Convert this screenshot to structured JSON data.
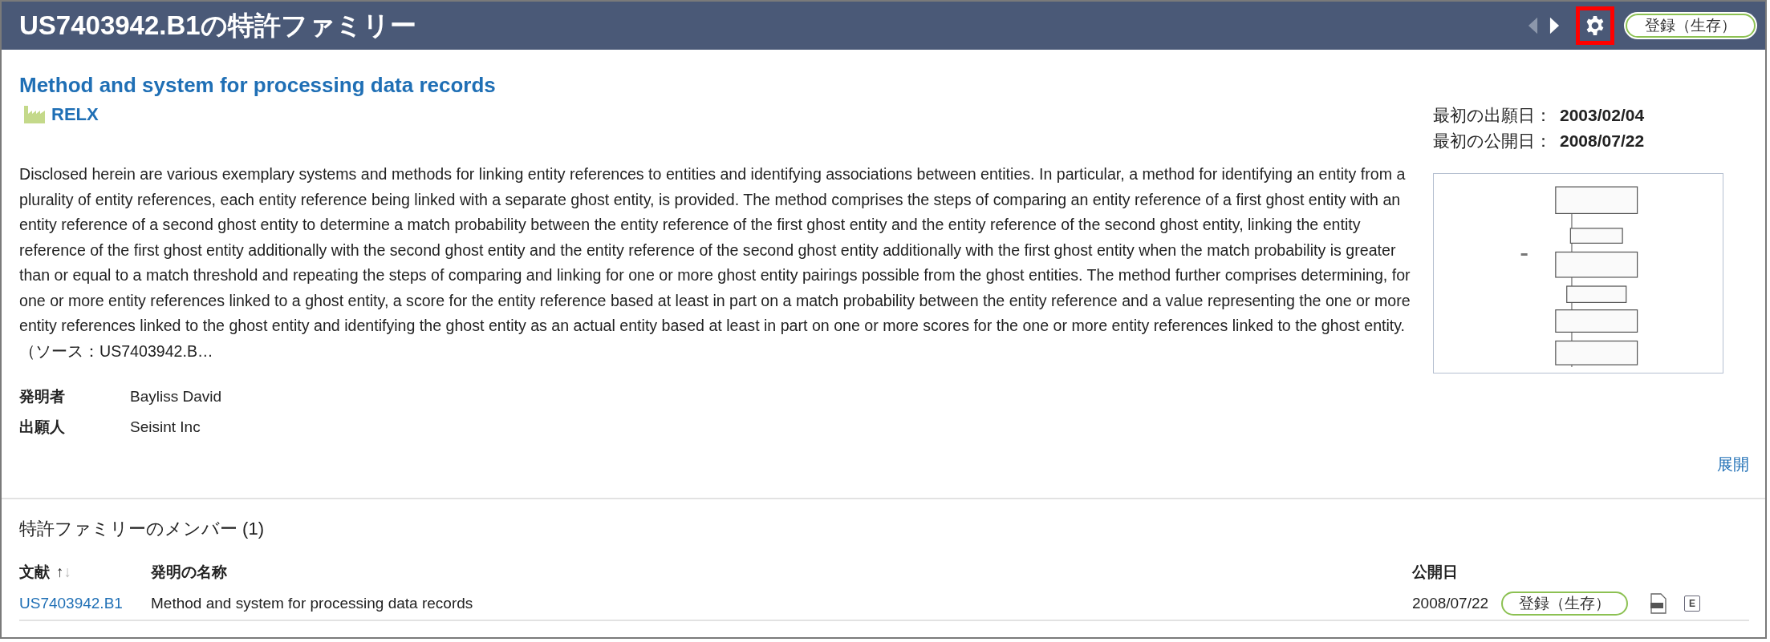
{
  "header": {
    "title": "US7403942.B1の特許ファミリー",
    "prev_enabled": false,
    "next_enabled": true,
    "settings_highlighted": true,
    "status_badge": "登録（生存）"
  },
  "patent": {
    "title": "Method and system for processing data records",
    "assignee": "RELX",
    "dates": [
      {
        "label": "最初の出願日：",
        "value": "2003/02/04"
      },
      {
        "label": "最初の公開日：",
        "value": "2008/07/22"
      }
    ],
    "abstract": "Disclosed herein are various exemplary systems and methods for linking entity references to entities and identifying associations between entities. In particular, a method for identifying an entity from a plurality of entity references, each entity reference being linked with a separate ghost entity, is provided. The method comprises the steps of comparing an entity reference of a first ghost entity with an entity reference of a second ghost entity to determine a match probability between the entity reference of the first ghost entity and the entity reference of the second ghost entity, linking the entity reference of the first ghost entity additionally with the second ghost entity and the entity reference of the second ghost entity additionally with the first ghost entity when the match probability is greater than or equal to a match threshold and repeating the steps of comparing and linking for one or more ghost entity pairings possible from the ghost entities. The method further comprises determining, for one or more entity references linked to a ghost entity, a score for the entity reference based at least in part on a match probability between the entity reference and a value representing the one or more entity references linked to the ghost entity and identifying the ghost entity as an actual entity based at least in part on one or more scores for the one or more entity references linked to the ghost entity.（ソース：US7403942.B…",
    "people": [
      {
        "label": "発明者",
        "value": "Bayliss David"
      },
      {
        "label": "出願人",
        "value": "Seisint Inc"
      }
    ],
    "expand_link": "展開"
  },
  "members": {
    "title": "特許ファミリーのメンバー (1)",
    "columns": [
      {
        "label": "文献",
        "sorted_ascending": true,
        "sort_up": "↑",
        "sort_down": "↓"
      },
      {
        "label": "発明の名称"
      },
      {
        "label": "公開日"
      }
    ],
    "rows": [
      {
        "number": "US7403942.B1",
        "title": "Method and system for processing data records",
        "date": "2008/07/22",
        "status": "登録（生存）",
        "extra_button": "E"
      }
    ]
  }
}
